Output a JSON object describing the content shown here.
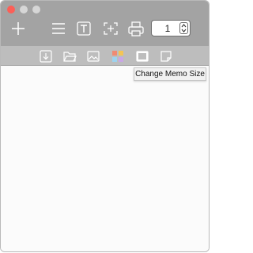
{
  "window": {
    "buttons": [
      "close",
      "minimize",
      "maximize"
    ]
  },
  "toolbar": {
    "items": [
      {
        "name": "add-icon"
      },
      {
        "name": "list-icon"
      },
      {
        "name": "text-icon"
      },
      {
        "name": "fit-screen-icon"
      },
      {
        "name": "print-icon"
      }
    ],
    "page_stepper_value": "1"
  },
  "toolbar2": {
    "items": [
      {
        "name": "download-icon"
      },
      {
        "name": "folder-icon"
      },
      {
        "name": "image-icon"
      },
      {
        "name": "color-grid-icon"
      },
      {
        "name": "memo-size-icon"
      },
      {
        "name": "note-icon"
      }
    ]
  },
  "tooltip": {
    "text": "Change Memo Size"
  },
  "colors": {
    "titlebar": "#a3a3a3",
    "toolbar2": "#bdbdbd",
    "close": "#fc5f57",
    "grid": [
      "#f08a73",
      "#f3c456",
      "#9dd3ef",
      "#c9a6e6"
    ]
  }
}
